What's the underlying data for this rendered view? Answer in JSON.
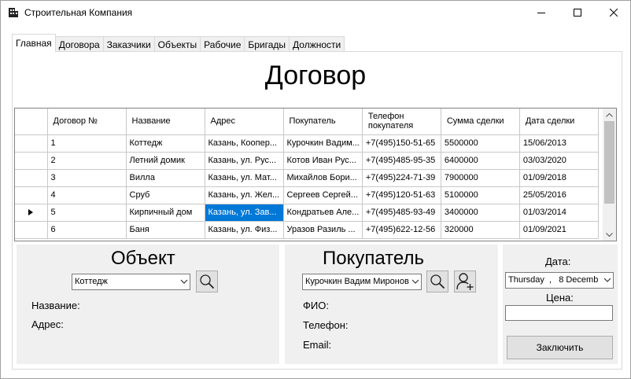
{
  "window": {
    "title": "Строительная Компания"
  },
  "tabs": [
    "Главная",
    "Договора",
    "Заказчики",
    "Объекты",
    "Рабочие",
    "Бригады",
    "Должности"
  ],
  "heading": "Договор",
  "grid": {
    "columns": [
      "Договор №",
      "Название",
      "Адрес",
      "Покупатель",
      "Телефон покупателя",
      "Сумма сделки",
      "Дата сделки"
    ],
    "rows": [
      [
        "1",
        "Коттедж",
        "Казань, Коопер...",
        "Курочкин Вадим...",
        "+7(495)150-51-65",
        "5500000",
        "15/06/2013"
      ],
      [
        "2",
        "Летний домик",
        "Казань, ул. Рус...",
        "Котов Иван Рус...",
        "+7(495)485-95-35",
        "6400000",
        "03/03/2020"
      ],
      [
        "3",
        "Вилла",
        "Казань, ул. Мат...",
        "Михайлов Бори...",
        "+7(495)224-71-39",
        "7900000",
        "01/09/2018"
      ],
      [
        "4",
        "Сруб",
        "Казань, ул. Жел...",
        "Сергеев Сергей...",
        "+7(495)120-51-63",
        "5100000",
        "25/05/2016"
      ],
      [
        "5",
        "Кирпичный дом",
        "Казань, ул. Зав...",
        "Кондратьев Але...",
        "+7(495)485-93-49",
        "3400000",
        "01/03/2014"
      ],
      [
        "6",
        "Баня",
        "Казань, ул. Физ...",
        "Уразов Разиль ...",
        "+7(495)622-12-56",
        "320000",
        "01/09/2021"
      ]
    ]
  },
  "object_panel": {
    "title": "Объект",
    "combo_value": "Коттедж",
    "name_label": "Название:",
    "address_label": "Адрес:"
  },
  "buyer_panel": {
    "title": "Покупатель",
    "combo_value": "Курочкин Вадим Миронов",
    "fio_label": "ФИО:",
    "phone_label": "Телефон:",
    "email_label": "Email:"
  },
  "deal_panel": {
    "date_label": "Дата:",
    "date_value": "Thursday  ,   8 Decemb",
    "price_label": "Цена:",
    "price_value": "",
    "submit_label": "Заключить"
  },
  "colors": {
    "selection": "#0078d7",
    "panel": "#f0f0f0"
  }
}
